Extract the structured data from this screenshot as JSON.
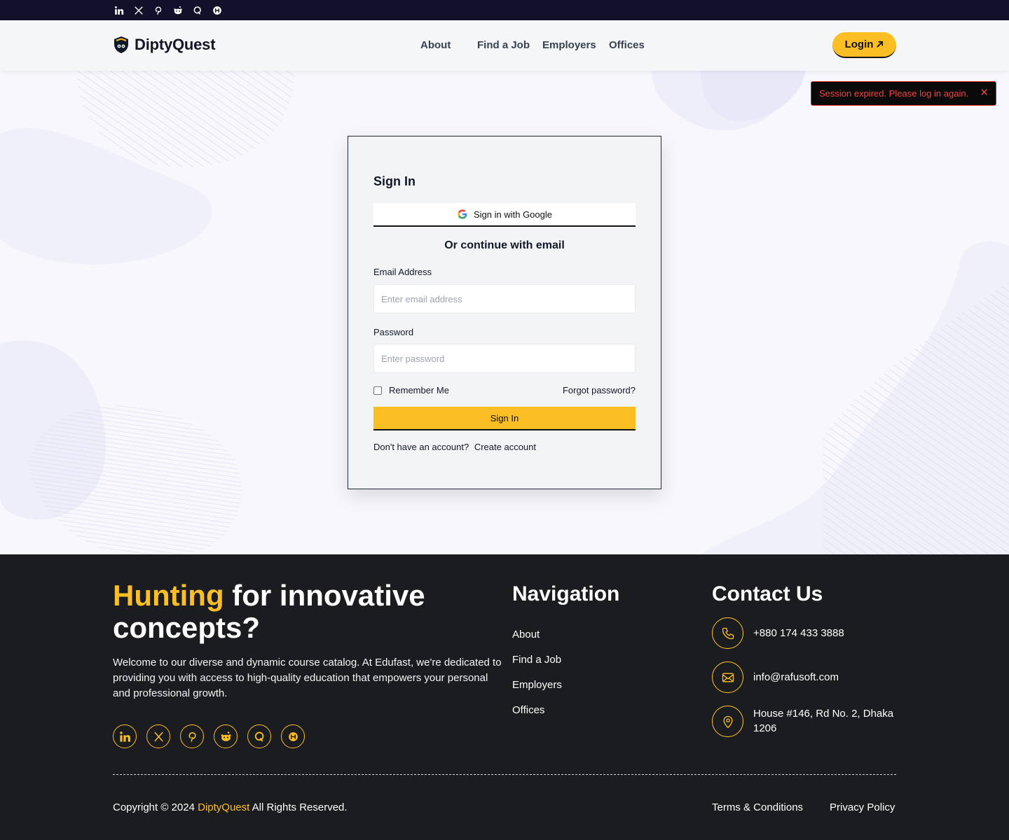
{
  "top_social": {
    "icons": [
      "linkedin-icon",
      "x-icon",
      "pinterest-icon",
      "reddit-icon",
      "quora-icon",
      "hackernoon-icon"
    ]
  },
  "header": {
    "brand": "DiptyQuest",
    "nav": [
      "About",
      "Find a Job",
      "Employers",
      "Offices"
    ],
    "login_label": "Login"
  },
  "toast": {
    "message": "Session expired. Please log in again.",
    "close": "✕"
  },
  "signin": {
    "title": "Sign In",
    "google_label": "Sign in with Google",
    "divider_text": "Or continue with email",
    "email_label": "Email Address",
    "email_placeholder": "Enter email address",
    "email_value": "",
    "password_label": "Password",
    "password_placeholder": "Enter password",
    "password_value": "",
    "remember_label": "Remember Me",
    "remember_checked": false,
    "forgot_label": "Forgot password?",
    "submit_label": "Sign In",
    "no_account_text": "Don't have an account?",
    "create_account_label": "Create account"
  },
  "footer": {
    "headline_accent": "Hunting",
    "headline_rest": " for innovative concepts?",
    "description": "Welcome to our diverse and dynamic course catalog. At Edufast, we're dedicated to providing you with access to high-quality education that empowers your personal and professional growth.",
    "social_icons": [
      "linkedin-icon",
      "x-icon",
      "pinterest-icon",
      "reddit-icon",
      "quora-icon",
      "hackernoon-icon"
    ],
    "navigation_title": "Navigation",
    "navigation_links": [
      "About",
      "Find a Job",
      "Employers",
      "Offices"
    ],
    "contact_title": "Contact Us",
    "phone": "+880 174 433 3888",
    "email": "info@rafusoft.com",
    "address": "House #146, Rd No. 2, Dhaka 1206",
    "copyright_prefix": "Copyright © 2024",
    "copyright_brand": "DiptyQuest",
    "copyright_suffix": "All Rights Reserved.",
    "terms_label": "Terms & Conditions",
    "privacy_label": "Privacy Policy"
  },
  "colors": {
    "accent": "#fbbf24",
    "topbar": "#12102a",
    "footer_bg": "#1b1c20",
    "error": "#ef4444"
  }
}
